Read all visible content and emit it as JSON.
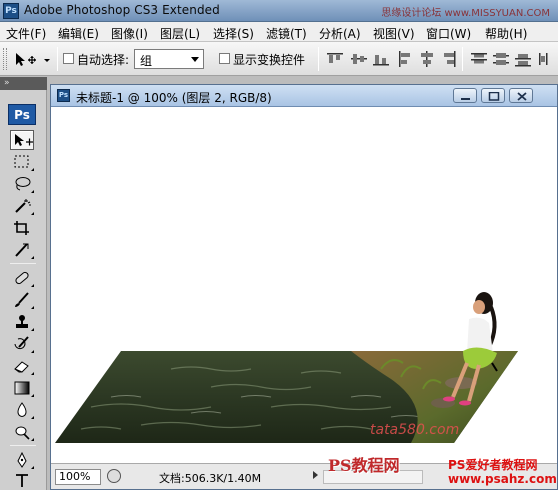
{
  "app": {
    "logo_text": "Ps",
    "title": "Adobe Photoshop CS3 Extended",
    "watermark_top": "思缘设计论坛 www.MISSYUAN.COM"
  },
  "menu": {
    "items": [
      "文件(F)",
      "编辑(E)",
      "图像(I)",
      "图层(L)",
      "选择(S)",
      "滤镜(T)",
      "分析(A)",
      "视图(V)",
      "窗口(W)",
      "帮助(H)"
    ]
  },
  "options": {
    "auto_select_label": "自动选择:",
    "auto_select_checked": false,
    "auto_select_value": "组",
    "show_transform_label": "显示变换控件",
    "show_transform_checked": false
  },
  "toolbox": {
    "ps_tab": "Ps",
    "tools": [
      "move-tool",
      "marquee-tool",
      "lasso-tool",
      "magic-wand-tool",
      "crop-tool",
      "slice-tool",
      "healing-brush-tool",
      "brush-tool",
      "clone-stamp-tool",
      "history-brush-tool",
      "eraser-tool",
      "gradient-tool",
      "blur-tool",
      "dodge-tool",
      "pen-tool",
      "type-tool"
    ],
    "active_tool": "move-tool"
  },
  "document": {
    "icon_text": "Ps",
    "title": "未标题-1 @ 100% (图层 2, RGB/8)",
    "zoom": "100%",
    "doc_size": "文档:506.3K/1.40M"
  },
  "watermarks": {
    "left_bottom": "PS教程网",
    "url_italic": "tata580.com",
    "right_bottom_1": "PS爱好者教程网",
    "right_bottom_2": "www.psahz.com"
  },
  "colors": {
    "title_bar": "#8aa7c8",
    "doc_title_bar": "#bcd2ec",
    "water": "#2e3b24",
    "ps_blue": "#1f5aa5"
  }
}
